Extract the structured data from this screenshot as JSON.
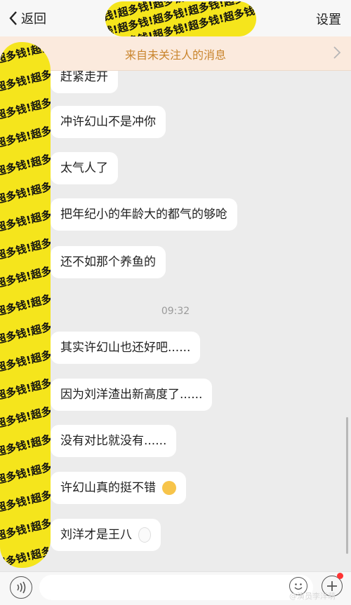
{
  "header": {
    "back_label": "返回",
    "settings_label": "设置"
  },
  "notice": {
    "text": "来自未关注人的消息"
  },
  "sticker": {
    "text": "钱!超多钱!超多钱!超多钱!超多钱!超多钱!超多"
  },
  "messages": [
    {
      "text": "赶紧走开"
    },
    {
      "text": "冲许幻山不是冲你"
    },
    {
      "text": "太气人了"
    },
    {
      "text": "把年纪小的年龄大的都气的够呛"
    },
    {
      "text": "还不如那个养鱼的"
    },
    {
      "text": "其实许幻山也还好吧......"
    },
    {
      "text": "因为刘洋渣出新高度了......"
    },
    {
      "text": "没有对比就没有......"
    },
    {
      "text": "许幻山真的挺不错"
    },
    {
      "text": "刘洋才是王八"
    }
  ],
  "timestamp": "09:32",
  "watermark": "@演员李洋萌",
  "colors": {
    "sticker_yellow": "#f5e51c",
    "notice_text": "#c9852d",
    "chat_bg": "#ececec"
  },
  "icons": [
    "chevron-left-icon",
    "chevron-right-icon",
    "voice-icon",
    "emoji-icon",
    "plus-icon"
  ]
}
